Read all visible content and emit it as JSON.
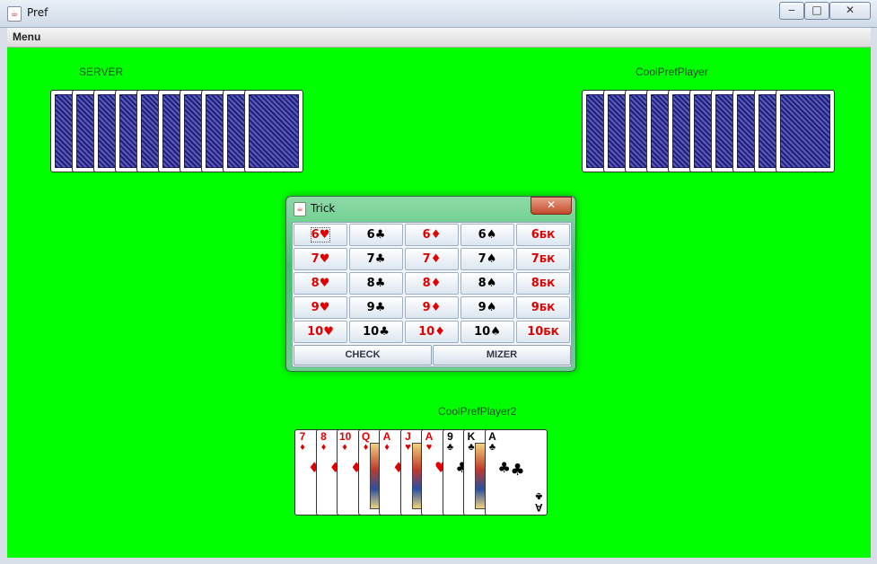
{
  "window": {
    "title": "Pref",
    "controls": {
      "minimize": "‒",
      "maximize": "□",
      "close": "✕"
    }
  },
  "menubar": {
    "menu": "Menu"
  },
  "players": {
    "left": "SERVER",
    "right": "CoolPrefPlayer",
    "bottom": "CoolPrefPlayer2"
  },
  "trick_dialog": {
    "title": "Trick",
    "close": "✕",
    "rows": [
      [
        {
          "rank": "6",
          "suit": "♥",
          "color": "red"
        },
        {
          "rank": "6",
          "suit": "♣",
          "color": "black"
        },
        {
          "rank": "6",
          "suit": "♦",
          "color": "red"
        },
        {
          "rank": "6",
          "suit": "♠",
          "color": "black"
        },
        {
          "rank": "6",
          "suit": "БК",
          "color": "red"
        }
      ],
      [
        {
          "rank": "7",
          "suit": "♥",
          "color": "red"
        },
        {
          "rank": "7",
          "suit": "♣",
          "color": "black"
        },
        {
          "rank": "7",
          "suit": "♦",
          "color": "red"
        },
        {
          "rank": "7",
          "suit": "♠",
          "color": "black"
        },
        {
          "rank": "7",
          "suit": "БК",
          "color": "red"
        }
      ],
      [
        {
          "rank": "8",
          "suit": "♥",
          "color": "red"
        },
        {
          "rank": "8",
          "suit": "♣",
          "color": "black"
        },
        {
          "rank": "8",
          "suit": "♦",
          "color": "red"
        },
        {
          "rank": "8",
          "suit": "♠",
          "color": "black"
        },
        {
          "rank": "8",
          "suit": "БК",
          "color": "red"
        }
      ],
      [
        {
          "rank": "9",
          "suit": "♥",
          "color": "red"
        },
        {
          "rank": "9",
          "suit": "♣",
          "color": "black"
        },
        {
          "rank": "9",
          "suit": "♦",
          "color": "red"
        },
        {
          "rank": "9",
          "suit": "♠",
          "color": "black"
        },
        {
          "rank": "9",
          "suit": "БК",
          "color": "red"
        }
      ],
      [
        {
          "rank": "10",
          "suit": "♥",
          "color": "red"
        },
        {
          "rank": "10",
          "suit": "♣",
          "color": "black"
        },
        {
          "rank": "10",
          "suit": "♦",
          "color": "red"
        },
        {
          "rank": "10",
          "suit": "♠",
          "color": "black"
        },
        {
          "rank": "10",
          "suit": "БК",
          "color": "red"
        }
      ]
    ],
    "check_label": "CHECK",
    "mizer_label": "MIZER"
  },
  "hand": [
    {
      "rank": "7",
      "suit": "♦",
      "color": "red"
    },
    {
      "rank": "8",
      "suit": "♦",
      "color": "red"
    },
    {
      "rank": "10",
      "suit": "♦",
      "color": "red"
    },
    {
      "rank": "Q",
      "suit": "♦",
      "color": "red"
    },
    {
      "rank": "A",
      "suit": "♦",
      "color": "red"
    },
    {
      "rank": "J",
      "suit": "♥",
      "color": "red"
    },
    {
      "rank": "A",
      "suit": "♥",
      "color": "red"
    },
    {
      "rank": "9",
      "suit": "♣",
      "color": "black"
    },
    {
      "rank": "K",
      "suit": "♣",
      "color": "black"
    },
    {
      "rank": "A",
      "suit": "♣",
      "color": "black"
    }
  ],
  "colors": {
    "table": "#00ff00",
    "card_back": "#2a2a8a",
    "red_suit": "#e00000"
  }
}
